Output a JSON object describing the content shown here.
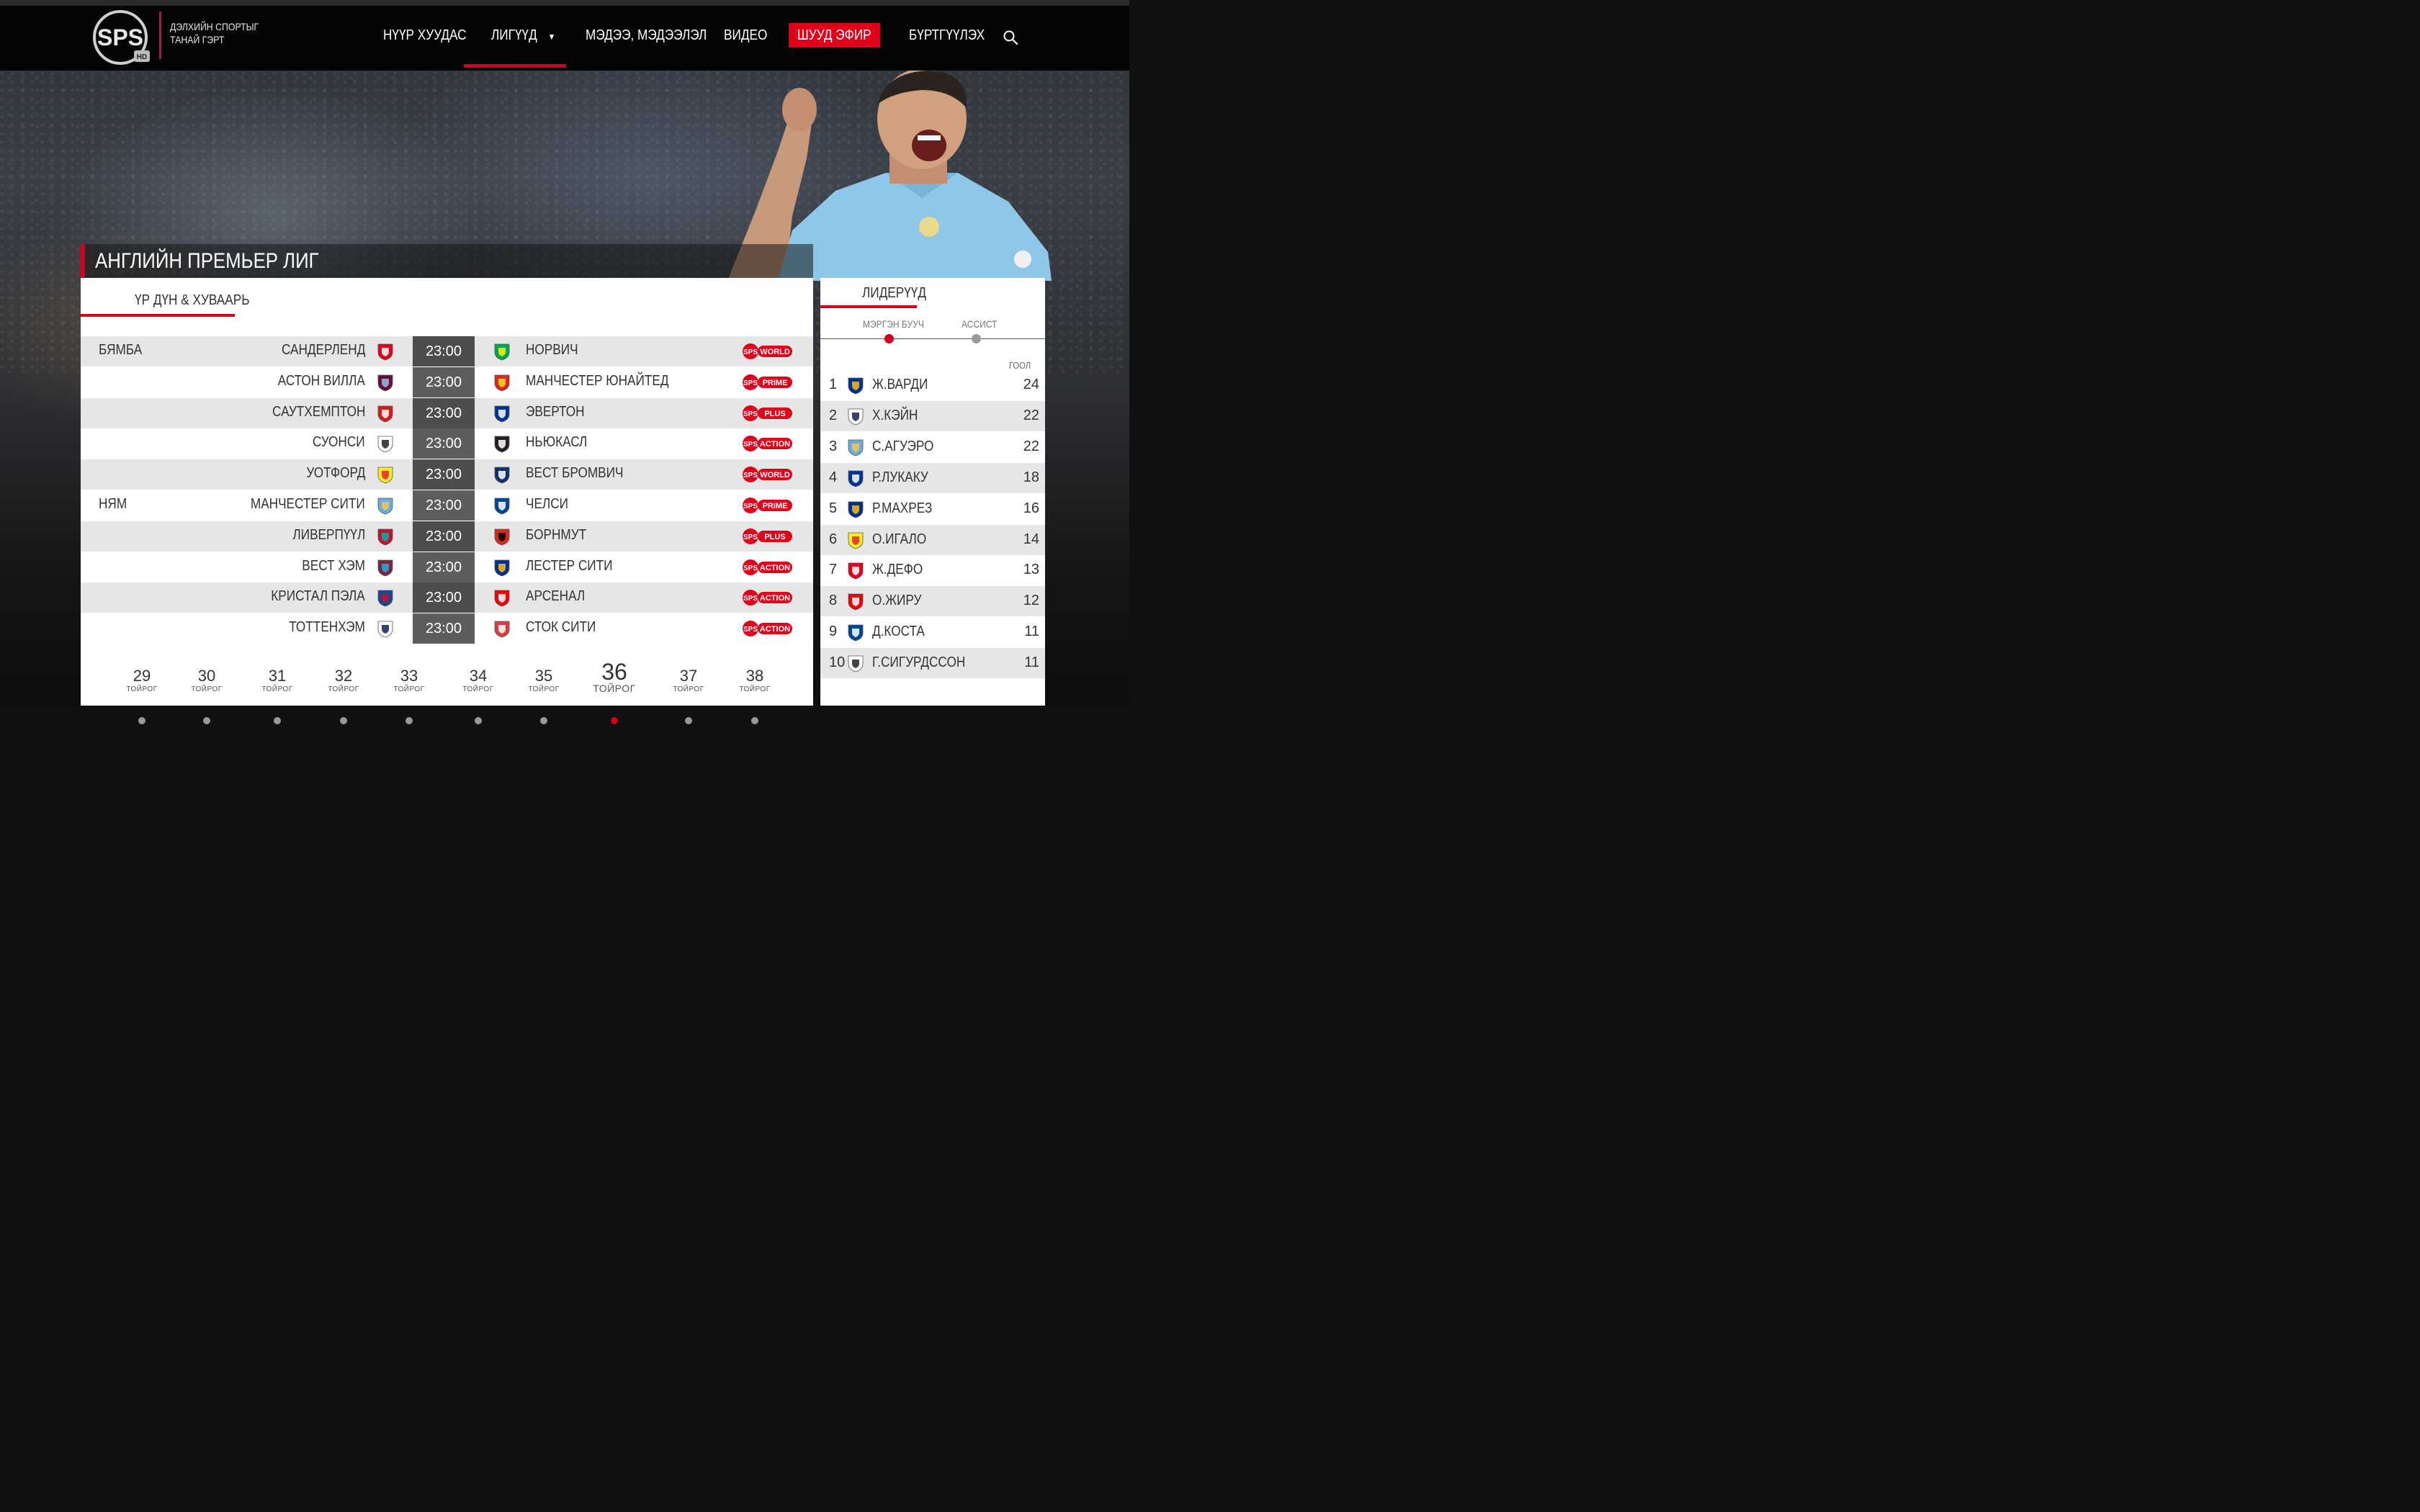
{
  "brand": {
    "logo_text": "SPS",
    "logo_sub": "HD",
    "tagline_line1": "ДЭЛХИЙН СПОРТЫГ",
    "tagline_line2": "ТАНАЙ ГЭРТ"
  },
  "nav": {
    "home": "НҮҮР ХУУДАС",
    "leagues": "ЛИГҮҮД",
    "leagues_caret": "▼",
    "news": "МЭДЭЭ, МЭДЭЭЛЭЛ",
    "video": "ВИДЕО",
    "live": "ШУУД ЭФИР",
    "register": "БҮРТГҮҮЛЭХ"
  },
  "colors": {
    "accent": "#d3001c",
    "live_bg": "#e3001b"
  },
  "league": {
    "title": "АНГЛИЙН ПРЕМЬЕР ЛИГ",
    "tab": "ҮР ДҮН & ХУВААРЬ"
  },
  "matches": [
    {
      "day": "БЯМБА",
      "home": "САНДЕРЛЕНД",
      "time": "23:00",
      "away": "НОРВИЧ",
      "channel": "WORLD",
      "home_crest": "sunderland-crest",
      "away_crest": "norwich-crest"
    },
    {
      "day": "",
      "home": "АСТОН ВИЛЛА",
      "time": "23:00",
      "away": "МАНЧЕСТЕР ЮНАЙТЕД",
      "channel": "PRIME",
      "home_crest": "aston-villa-crest",
      "away_crest": "man-united-crest"
    },
    {
      "day": "",
      "home": "САУТХЕМПТОН",
      "time": "23:00",
      "away": "ЭВЕРТОН",
      "channel": "PLUS",
      "home_crest": "southampton-crest",
      "away_crest": "everton-crest"
    },
    {
      "day": "",
      "home": "СУОНСИ",
      "time": "23:00",
      "away": "НЬЮКАСЛ",
      "channel": "ACTION",
      "home_crest": "swansea-crest",
      "away_crest": "newcastle-crest"
    },
    {
      "day": "",
      "home": "УОТФОРД",
      "time": "23:00",
      "away": "ВЕСТ БРОМВИЧ",
      "channel": "WORLD",
      "home_crest": "watford-crest",
      "away_crest": "west-brom-crest"
    },
    {
      "day": "НЯМ",
      "home": "МАНЧЕСТЕР СИТИ",
      "time": "23:00",
      "away": "ЧЕЛСИ",
      "channel": "PRIME",
      "home_crest": "man-city-crest",
      "away_crest": "chelsea-crest"
    },
    {
      "day": "",
      "home": "ЛИВЕРПҮҮЛ",
      "time": "23:00",
      "away": "БОРНМУТ",
      "channel": "PLUS",
      "home_crest": "liverpool-crest",
      "away_crest": "bournemouth-crest"
    },
    {
      "day": "",
      "home": "ВЕСТ ХЭМ",
      "time": "23:00",
      "away": "ЛЕСТЕР СИТИ",
      "channel": "ACTION",
      "home_crest": "west-ham-crest",
      "away_crest": "leicester-crest"
    },
    {
      "day": "",
      "home": "КРИСТАЛ ПЭЛА",
      "time": "23:00",
      "away": "АРСЕНАЛ",
      "channel": "ACTION",
      "home_crest": "crystal-palace-crest",
      "away_crest": "arsenal-crest"
    },
    {
      "day": "",
      "home": "ТОТТЕНХЭМ",
      "time": "23:00",
      "away": "СТОК СИТИ",
      "channel": "ACTION",
      "home_crest": "tottenham-crest",
      "away_crest": "stoke-crest"
    }
  ],
  "channel_prefix": "SPS",
  "rounds": {
    "label": "ТОЙРОГ",
    "items": [
      "29",
      "30",
      "31",
      "32",
      "33",
      "34",
      "35",
      "36",
      "37",
      "38"
    ],
    "active": "36"
  },
  "leaders": {
    "tab": "ЛИДЕРҮҮД",
    "sub_scorers": "МЭРГЭН БУУЧ",
    "sub_assists": "АССИСТ",
    "goal_header": "ГООЛ",
    "rows": [
      {
        "rank": "1",
        "name": "Ж.ВАРДИ",
        "goals": "24",
        "club": "leicester-crest"
      },
      {
        "rank": "2",
        "name": "Х.КЭЙН",
        "goals": "22",
        "club": "tottenham-crest"
      },
      {
        "rank": "3",
        "name": "С.АГУЭРО",
        "goals": "22",
        "club": "man-city-crest"
      },
      {
        "rank": "4",
        "name": "Р.ЛУКАКУ",
        "goals": "18",
        "club": "everton-crest"
      },
      {
        "rank": "5",
        "name": "Р.МАХРЕЗ",
        "goals": "16",
        "club": "leicester-crest"
      },
      {
        "rank": "6",
        "name": "О.ИГАЛО",
        "goals": "14",
        "club": "watford-crest"
      },
      {
        "rank": "7",
        "name": "Ж.ДЕФО",
        "goals": "13",
        "club": "sunderland-crest"
      },
      {
        "rank": "8",
        "name": "О.ЖИРУ",
        "goals": "12",
        "club": "arsenal-crest"
      },
      {
        "rank": "9",
        "name": "Д.КОСТА",
        "goals": "11",
        "club": "chelsea-crest"
      },
      {
        "rank": "10",
        "name": "Г.СИГУРДССОН",
        "goals": "11",
        "club": "swansea-crest"
      }
    ]
  }
}
